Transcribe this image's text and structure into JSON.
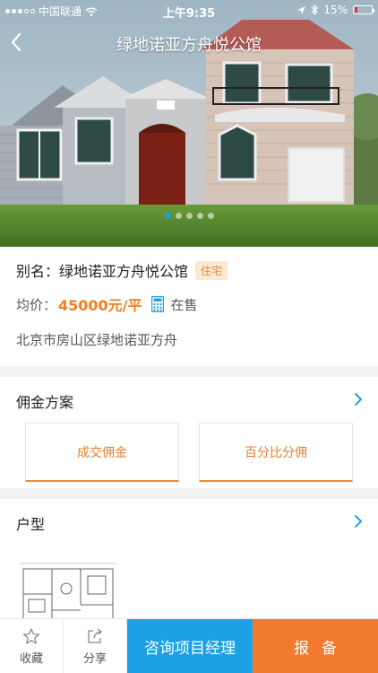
{
  "status": {
    "carrier": "中国联通",
    "time": "上午9:35",
    "battery": "15%"
  },
  "nav": {
    "title": "绿地诺亚方舟悦公馆"
  },
  "gallery": {
    "total": 5,
    "active_index": 0
  },
  "project": {
    "alias_label": "别名：",
    "alias": "绿地诺亚方舟悦公馆",
    "tag": "住宅",
    "price_label": "均价：",
    "price": "45000元/平",
    "sale_status": "在售",
    "address": "北京市房山区绿地诺亚方舟"
  },
  "commission": {
    "title": "佣金方案",
    "option1": "成交佣金",
    "option2": "百分比分佣"
  },
  "layout_section": {
    "title": "户型"
  },
  "bottom": {
    "favorite": "收藏",
    "share": "分享",
    "consult": "咨询项目经理",
    "report": "报备"
  },
  "colors": {
    "accent_blue": "#1ea0e6",
    "accent_orange": "#f27a2f",
    "price_orange": "#f07e22"
  }
}
